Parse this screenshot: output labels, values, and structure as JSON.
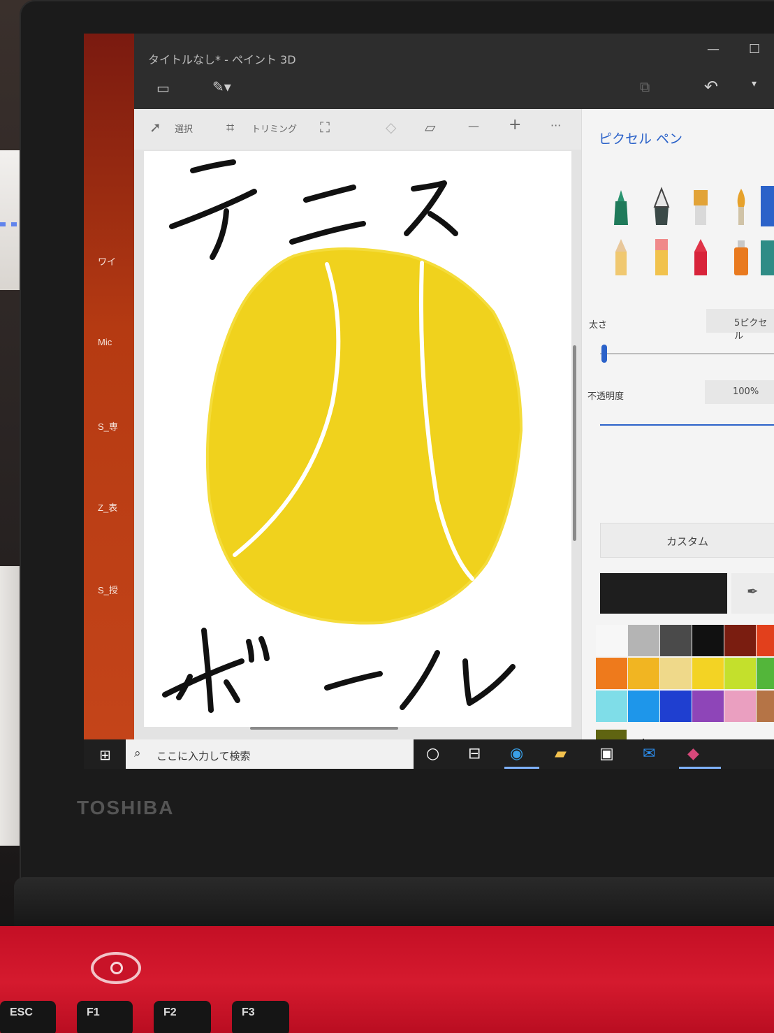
{
  "window": {
    "title": "タイトルなし* - ペイント 3D",
    "minimize_glyph": "—",
    "maximize_glyph": "☐"
  },
  "toolbar": {
    "undo_icon": "↶",
    "more_icon": "▾"
  },
  "ribbon": {
    "select_label": "選択",
    "crop_label": "トリミング",
    "more_label": "···",
    "zoom_out": "—",
    "zoom_in": "+"
  },
  "desktop": {
    "icon_labels": [
      "ワイ",
      "Mic",
      "S_専",
      "Z_表",
      "S_授"
    ]
  },
  "panel": {
    "title": "ピクセル ペン",
    "thickness_label": "太さ",
    "thickness_value": "5ピクセル",
    "thickness_fraction": 0.02,
    "opacity_label": "不透明度",
    "opacity_value": "100%",
    "opacity_fraction": 1.0,
    "color_mode": "カスタム",
    "current_color": "#1e1e1e",
    "custom_color": "#5f6411",
    "palette": [
      [
        "#f7f7f7",
        "#b4b4b4",
        "#4a4a4a",
        "#111111",
        "#7a1d10",
        "#e2401c"
      ],
      [
        "#ee7a1c",
        "#f1b522",
        "#efd98a",
        "#f3d324",
        "#c4e02c",
        "#53b63a"
      ],
      [
        "#7fdde8",
        "#1e96ea",
        "#1f3fd0",
        "#8e45b8",
        "#ea9fc0",
        "#b57446"
      ]
    ]
  },
  "canvas": {
    "drawing": "テニスボール"
  },
  "taskbar": {
    "search_placeholder": "ここに入力して検索"
  },
  "laptop": {
    "brand": "TOSHIBA",
    "keys": [
      "ESC",
      "F1",
      "F2",
      "F3"
    ]
  }
}
